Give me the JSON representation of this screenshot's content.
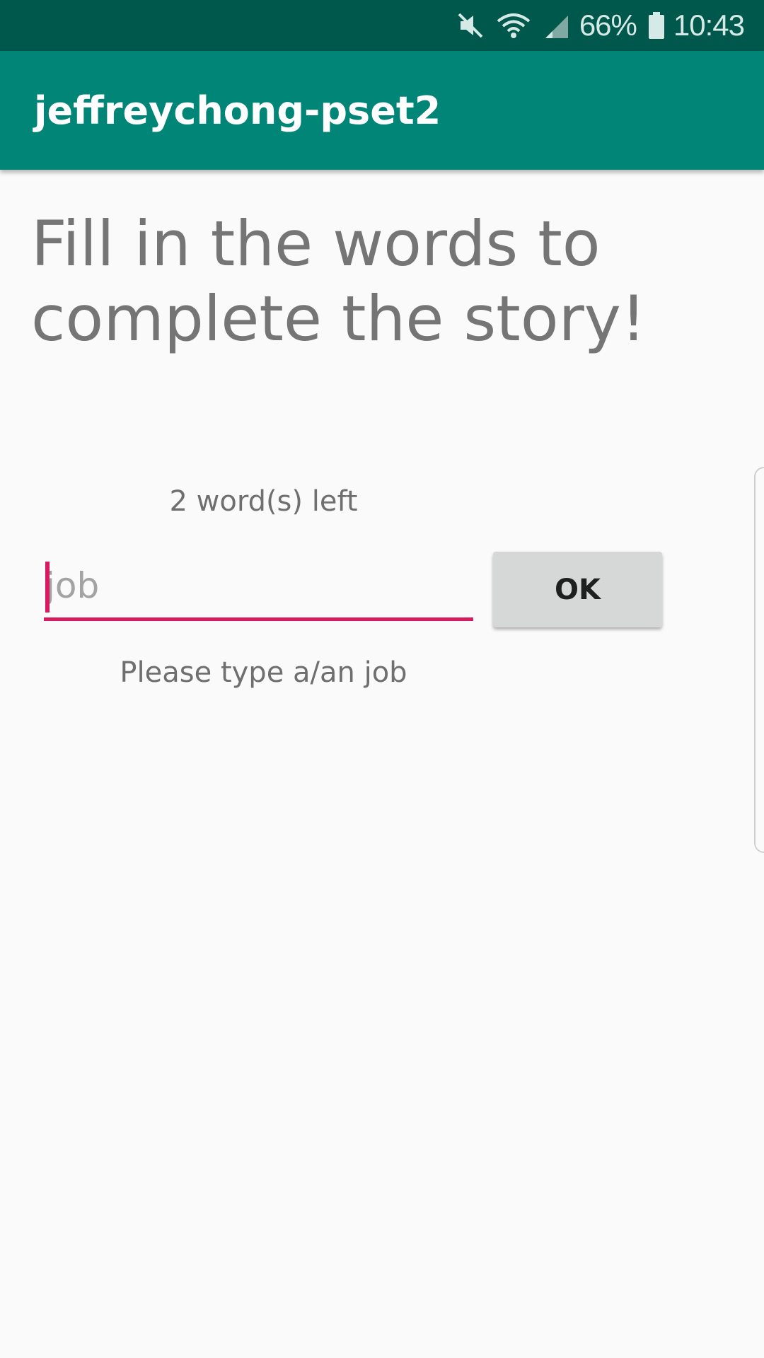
{
  "status_bar": {
    "battery_percent": "66%",
    "time": "10:43",
    "icons": [
      "mute-icon",
      "wifi-icon",
      "signal-icon",
      "battery-icon"
    ]
  },
  "app_bar": {
    "title": "jeffreychong-pset2"
  },
  "main": {
    "headline": "Fill in the words to complete the story!",
    "words_left": "2 word(s) left",
    "input_placeholder": "job",
    "input_value": "",
    "ok_label": "OK",
    "hint": "Please type a/an job"
  },
  "colors": {
    "status_bar": "#00574b",
    "app_bar": "#008577",
    "accent": "#d81b60"
  }
}
